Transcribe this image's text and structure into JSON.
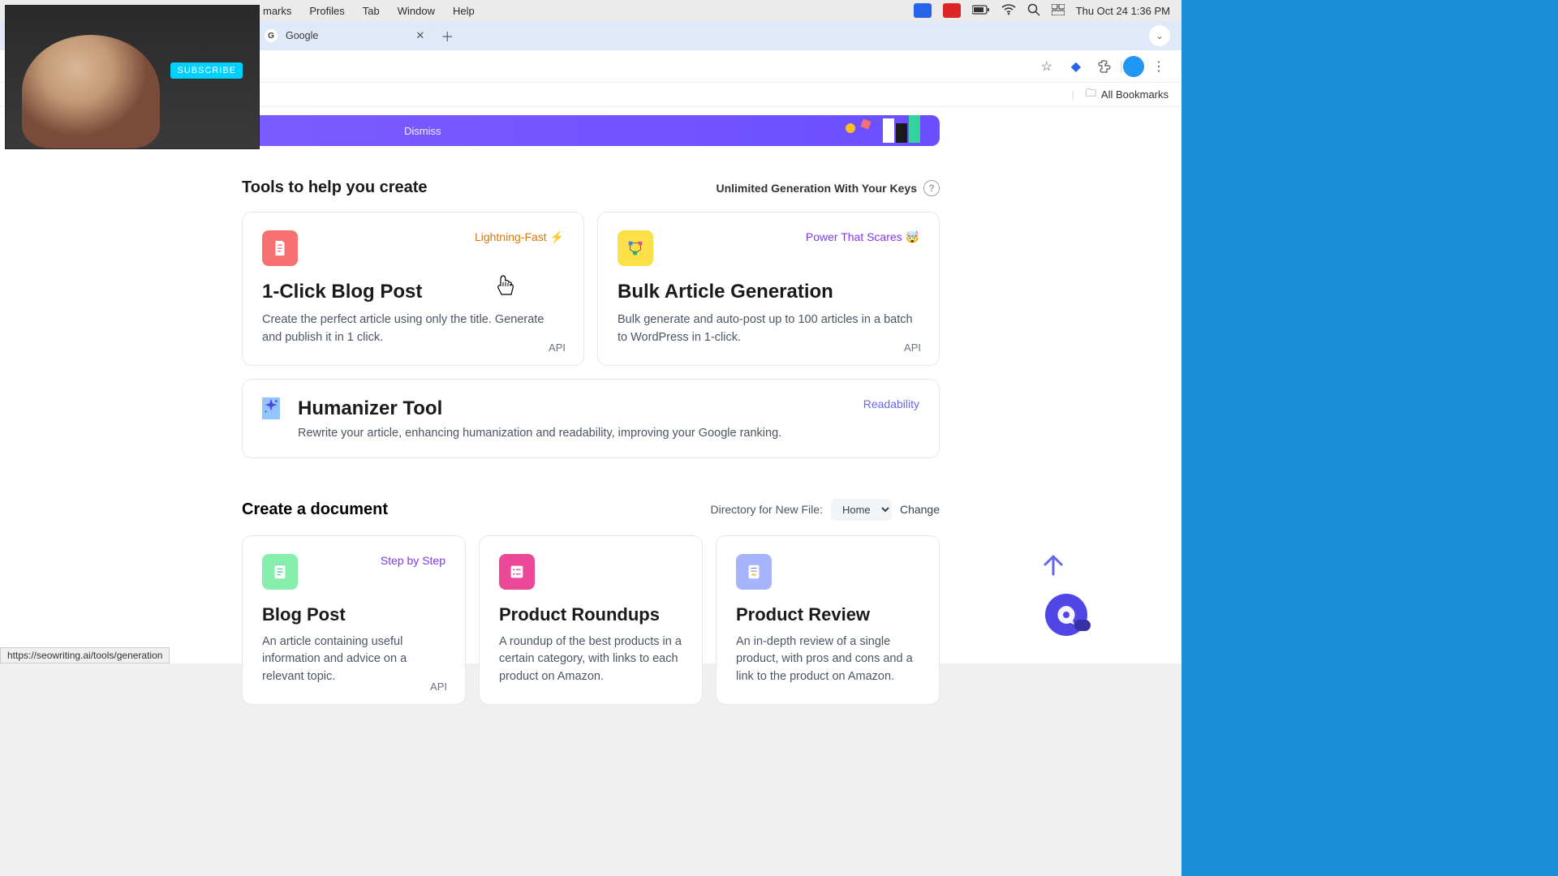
{
  "menubar": {
    "items": [
      "marks",
      "Profiles",
      "Tab",
      "Window",
      "Help"
    ],
    "clock": "Thu Oct 24  1:36 PM"
  },
  "tab": {
    "title": "Google"
  },
  "bookmarks": {
    "all": "All Bookmarks"
  },
  "promo": {
    "dismiss": "Dismiss"
  },
  "webcam": {
    "subscribe": "SUBSCRIBE"
  },
  "tools": {
    "heading": "Tools to help you create",
    "right_label": "Unlimited Generation With Your Keys",
    "cards": [
      {
        "tag": "Lightning-Fast ⚡",
        "title": "1-Click Blog Post",
        "desc": "Create the perfect article using only the title. Generate and publish it in 1 click.",
        "api": "API"
      },
      {
        "tag": "Power That Scares 🤯",
        "title": "Bulk Article Generation",
        "desc": "Bulk generate and auto-post up to 100 articles in a batch to WordPress in 1-click.",
        "api": "API"
      }
    ],
    "humanizer": {
      "title": "Humanizer Tool",
      "desc": "Rewrite your article, enhancing humanization and readability, improving your Google ranking.",
      "tag": "Readability"
    }
  },
  "create": {
    "heading": "Create a document",
    "dir_label": "Directory for New File:",
    "dir_value": "Home",
    "change": "Change",
    "cards": [
      {
        "tag": "Step by Step",
        "title": "Blog Post",
        "desc": "An article containing useful information and advice on a relevant topic.",
        "api": "API"
      },
      {
        "tag": "",
        "title": "Product Roundups",
        "desc": "A roundup of the best products in a certain category, with links to each product on Amazon.",
        "api": ""
      },
      {
        "tag": "",
        "title": "Product Review",
        "desc": "An in-depth review of a single product, with pros and cons and a link to the product on Amazon.",
        "api": ""
      }
    ]
  },
  "status_url": "https://seowriting.ai/tools/generation"
}
